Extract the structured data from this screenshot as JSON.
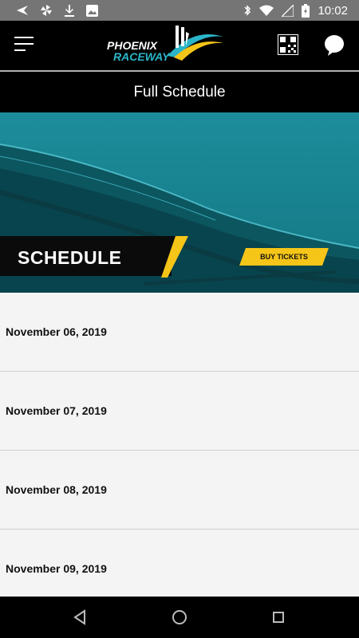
{
  "status_bar": {
    "time": "10:02"
  },
  "app_bar": {
    "logo_line1": "PHOENIX",
    "logo_line2": "RACEWAY"
  },
  "page": {
    "title": "Full Schedule"
  },
  "hero": {
    "heading": "SCHEDULE",
    "button_label": "BUY TICKETS"
  },
  "schedule": {
    "dates": [
      "November 06, 2019",
      "November 07, 2019",
      "November 08, 2019",
      "November 09, 2019"
    ]
  },
  "colors": {
    "accent": "#f5c518",
    "teal": "#1a8b99",
    "logo_teal": "#2bb5c8"
  },
  "icons": [
    "menu-icon",
    "qr-code-icon",
    "chat-bubble-icon",
    "back-icon",
    "home-icon",
    "recents-icon"
  ]
}
